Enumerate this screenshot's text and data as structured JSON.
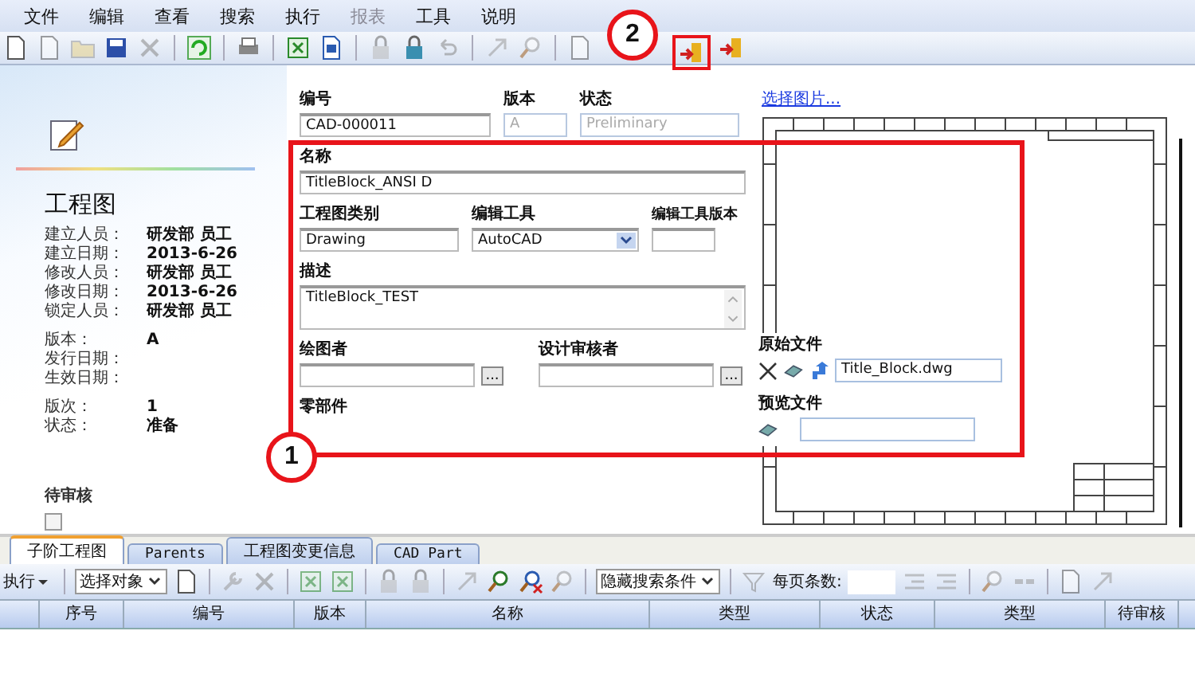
{
  "menu": [
    {
      "label": "文件",
      "disabled": false
    },
    {
      "label": "编辑",
      "disabled": false
    },
    {
      "label": "查看",
      "disabled": false
    },
    {
      "label": "搜索",
      "disabled": false
    },
    {
      "label": "执行",
      "disabled": false
    },
    {
      "label": "报表",
      "disabled": true
    },
    {
      "label": "工具",
      "disabled": false
    },
    {
      "label": "说明",
      "disabled": false
    }
  ],
  "summary": {
    "title": "工程图",
    "groups": [
      [
        {
          "label": "建立人员：",
          "value": "研发部 员工"
        },
        {
          "label": "建立日期：",
          "value": "2013-6-26"
        },
        {
          "label": "修改人员：",
          "value": "研发部 员工"
        },
        {
          "label": "修改日期：",
          "value": "2013-6-26"
        },
        {
          "label": "锁定人员：",
          "value": "研发部 员工"
        }
      ],
      [
        {
          "label": "版本：",
          "value": "A"
        },
        {
          "label": "发行日期："
        },
        {
          "label": "生效日期："
        }
      ],
      [
        {
          "label": "版次：",
          "value": "1"
        },
        {
          "label": "状态：",
          "value": "准备"
        }
      ]
    ],
    "review": {
      "label": "待审核",
      "checked": false
    }
  },
  "form": {
    "number": {
      "label": "编号",
      "value": "CAD-000011"
    },
    "revision": {
      "label": "版本",
      "value": "A",
      "disabled": true
    },
    "state": {
      "label": "状态",
      "value": "Preliminary",
      "disabled": true
    },
    "name": {
      "label": "名称",
      "value": "TitleBlock_ANSI D"
    },
    "category": {
      "label": "工程图类别",
      "value": "Drawing"
    },
    "tool": {
      "label": "编辑工具",
      "value": "AutoCAD"
    },
    "tool_version": {
      "label": "编辑工具版本"
    },
    "description": {
      "label": "描述",
      "value": "TitleBlock_TEST"
    },
    "drawer": {
      "label": "绘图者",
      "button": "..."
    },
    "reviewer": {
      "label": "设计审核者",
      "button": "..."
    },
    "parts": {
      "label": "零部件"
    }
  },
  "preview": {
    "link": "选择图片...",
    "source_file": {
      "label": "原始文件",
      "value": "Title_Block.dwg"
    },
    "preview_file": {
      "label": "预览文件"
    }
  },
  "callouts": [
    {
      "label": "1"
    },
    {
      "label": "2"
    }
  ],
  "tabs": [
    {
      "label": "子阶工程图",
      "selected": true
    },
    {
      "label": "Parents",
      "selected": false
    },
    {
      "label": "工程图变更信息",
      "selected": false
    },
    {
      "label": "CAD Part",
      "selected": false
    }
  ],
  "list_toolbar": {
    "execute": "执行",
    "object_select": "选择对象",
    "search_toggle": "隐藏搜索条件",
    "page_size_label": "每页条数:"
  },
  "table": {
    "columns": [
      "",
      "序号",
      "编号",
      "版本",
      "名称",
      "类型",
      "状态",
      "类型",
      "待审核"
    ]
  }
}
